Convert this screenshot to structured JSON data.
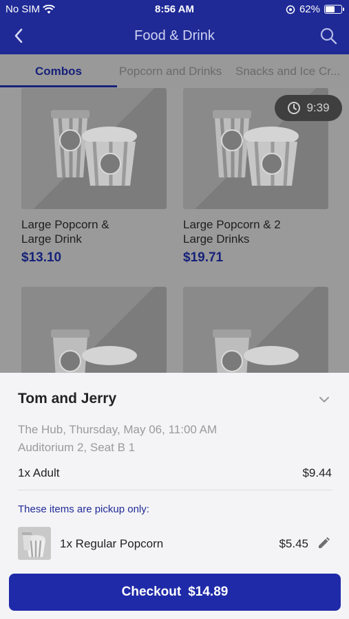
{
  "status_bar": {
    "carrier": "No SIM",
    "time": "8:56 AM",
    "battery": "62%",
    "battery_level": 0.62
  },
  "header": {
    "title": "Food & Drink",
    "back_icon": "chevron-left-icon",
    "search_icon": "search-icon"
  },
  "tabs": [
    {
      "label": "Combos",
      "active": true
    },
    {
      "label": "Popcorn and Drinks",
      "active": false
    },
    {
      "label": "Snacks and Ice Cr...",
      "active": false
    }
  ],
  "timer": {
    "label": "9:39",
    "icon": "clock-icon"
  },
  "products": [
    {
      "name_line1": "Large Popcorn &",
      "name_line2": "Large Drink",
      "price": "$13.10"
    },
    {
      "name_line1": "Large Popcorn & 2",
      "name_line2": "Large Drinks",
      "price": "$19.71"
    },
    {
      "name_line1": "",
      "name_line2": "",
      "price": ""
    },
    {
      "name_line1": "",
      "name_line2": "",
      "price": ""
    }
  ],
  "order": {
    "movie_title": "Tom and Jerry",
    "venue_line": "The Hub, Thursday, May 06, 11:00 AM",
    "seat_line": "Auditorium 2, Seat B 1",
    "ticket": {
      "label": "1x Adult",
      "price": "$9.44"
    },
    "pickup_notice": "These items are pickup only:",
    "items": [
      {
        "label": "1x Regular Popcorn",
        "price": "$5.45"
      }
    ],
    "checkout": {
      "label": "Checkout",
      "total": "$14.89"
    }
  },
  "colors": {
    "brand": "#1f2a96",
    "button": "#1f2aa8",
    "price": "#16217a"
  }
}
